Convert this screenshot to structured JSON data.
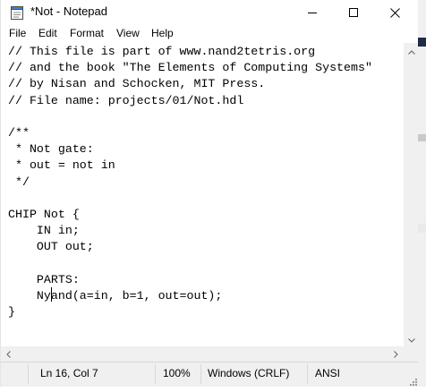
{
  "window": {
    "title": "*Not - Notepad"
  },
  "icons": {
    "app": "notepad-icon",
    "minimize": "minimize-icon",
    "maximize": "maximize-icon",
    "close": "close-icon",
    "scroll_up": "chevron-up-icon",
    "scroll_down": "chevron-down-icon",
    "scroll_left": "chevron-left-icon",
    "scroll_right": "chevron-right-icon",
    "grip": "resize-grip-icon"
  },
  "menu": {
    "items": [
      "File",
      "Edit",
      "Format",
      "View",
      "Help"
    ]
  },
  "editor": {
    "text": "// This file is part of www.nand2tetris.org\n// and the book \"The Elements of Computing Systems\"\n// by Nisan and Schocken, MIT Press.\n// File name: projects/01/Not.hdl\n\n/**\n * Not gate:\n * out = not in\n */\n\nCHIP Not {\n    IN in;\n    OUT out;\n\n    PARTS:\n    Nyand(a=in, b=1, out=out);\n}"
  },
  "status": {
    "position": "Ln 16, Col 7",
    "zoom": "100%",
    "line_ending": "Windows (CRLF)",
    "encoding": "ANSI"
  },
  "colors": {
    "chrome": "#f0f0f0",
    "text": "#000000",
    "editor_bg": "#ffffff"
  }
}
